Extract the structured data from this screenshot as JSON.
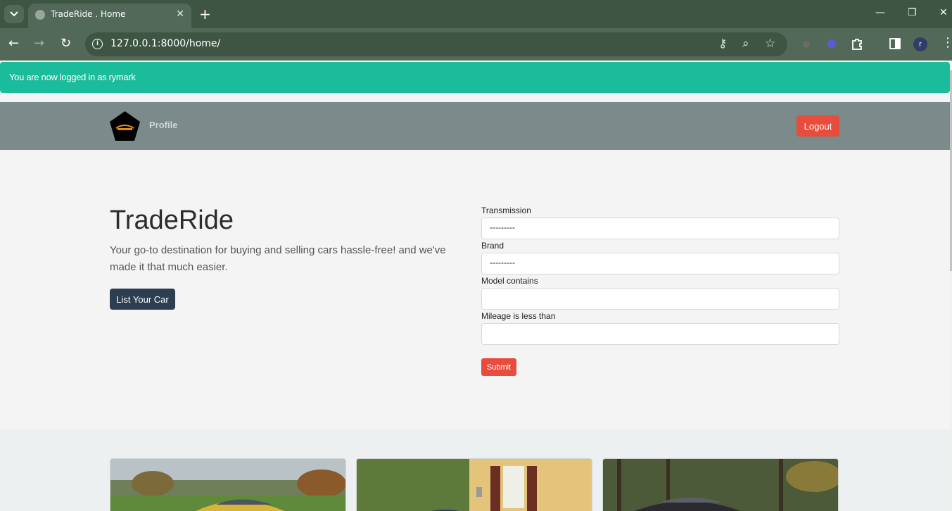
{
  "browser": {
    "tab_title": "TradeRide . Home",
    "url": "127.0.0.1:8000/home/",
    "profile_initial": "r"
  },
  "alert": {
    "message": "You are now logged in as rymark"
  },
  "navbar": {
    "profile_label": "Profile",
    "logout_label": "Logout"
  },
  "hero": {
    "title": "TradeRide",
    "description": "Your go-to destination for buying and selling cars hassle-free! and we've made it that much easier.",
    "cta_label": "List Your Car"
  },
  "filter_form": {
    "transmission_label": "Transmission",
    "transmission_value": "---------",
    "brand_label": "Brand",
    "brand_value": "---------",
    "model_label": "Model contains",
    "model_value": "",
    "mileage_label": "Mileage is less than",
    "mileage_value": "",
    "submit_label": "Submit"
  },
  "colors": {
    "alert": "#1abc9c",
    "navbar": "#7b8a8b",
    "danger": "#e74c3c",
    "primary": "#2c3e50"
  }
}
